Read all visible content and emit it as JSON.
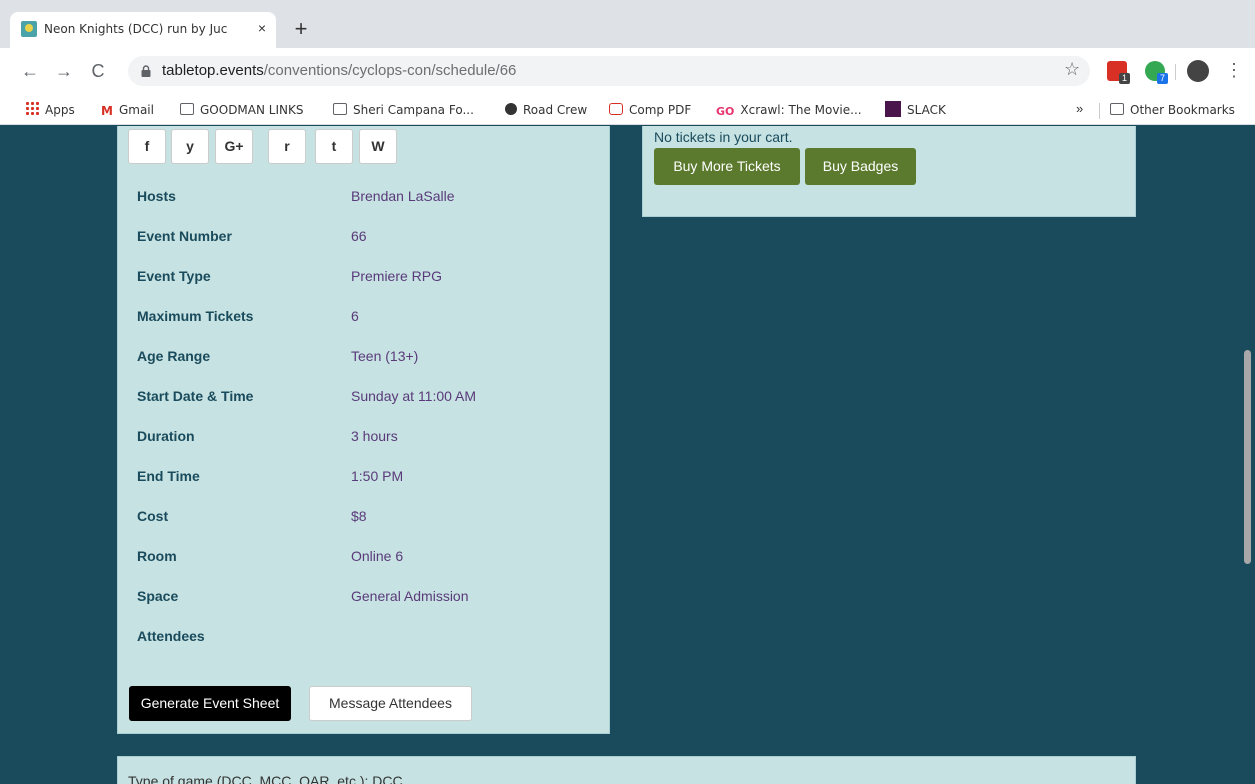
{
  "browser": {
    "tab_title": "Neon Knights (DCC) run by Juc",
    "close_glyph": "×",
    "new_tab_glyph": "+",
    "url_host": "tabletop.events",
    "url_path": "/conventions/cyclops-con/schedule/66",
    "back_glyph": "←",
    "forward_glyph": "→",
    "reload_glyph": "C",
    "star_glyph": "☆",
    "menu_glyph": "⋮",
    "extensions": [
      {
        "name": "ext-red",
        "color": "#d93025",
        "badge": "1",
        "badge_color": "#444"
      },
      {
        "name": "ext-green",
        "color": "#34a853",
        "badge": "7",
        "badge_color": "#1a73e8"
      }
    ]
  },
  "bookmarks": {
    "items": [
      {
        "label": "Apps",
        "icon": "apps-grid-icon"
      },
      {
        "label": "Gmail",
        "icon": "gmail-icon"
      },
      {
        "label": "GOODMAN LINKS",
        "icon": "folder-icon"
      },
      {
        "label": "Sheri Campana Fo...",
        "icon": "folder-icon"
      },
      {
        "label": "Road Crew",
        "icon": "globe-icon"
      },
      {
        "label": "Comp PDF",
        "icon": "pdf-icon"
      },
      {
        "label": "Xcrawl: The Movie...",
        "icon": "go-icon"
      },
      {
        "label": "SLACK",
        "icon": "slack-icon"
      }
    ],
    "more_glyph": "»",
    "other": "Other Bookmarks"
  },
  "social": [
    "f",
    "y",
    "G+",
    "r",
    "t",
    "W"
  ],
  "details": [
    {
      "label": "Hosts",
      "value": "Brendan LaSalle"
    },
    {
      "label": "Event Number",
      "value": "66"
    },
    {
      "label": "Event Type",
      "value": "Premiere RPG"
    },
    {
      "label": "Maximum Tickets",
      "value": "6"
    },
    {
      "label": "Age Range",
      "value": "Teen (13+)"
    },
    {
      "label": "Start Date & Time",
      "value": "Sunday at 11:00 AM"
    },
    {
      "label": "Duration",
      "value": "3 hours"
    },
    {
      "label": "End Time",
      "value": "1:50 PM"
    },
    {
      "label": "Cost",
      "value": "$8"
    },
    {
      "label": "Room",
      "value": "Online 6"
    },
    {
      "label": "Space",
      "value": "General Admission"
    },
    {
      "label": "Attendees",
      "value": ""
    }
  ],
  "actions": {
    "generate_sheet": "Generate Event Sheet",
    "message_attendees": "Message Attendees"
  },
  "cart": {
    "empty_text": "No tickets in your cart.",
    "buy_tickets": "Buy More Tickets",
    "buy_badges": "Buy Badges"
  },
  "description": {
    "game_type": "Type of game (DCC, MCC, OAR, etc.): DCC"
  },
  "colors": {
    "page_bg": "#1a4b5c",
    "panel_bg": "#c6e2e2",
    "green_button": "#5b7a2e",
    "value_text": "#5a3a7a"
  }
}
